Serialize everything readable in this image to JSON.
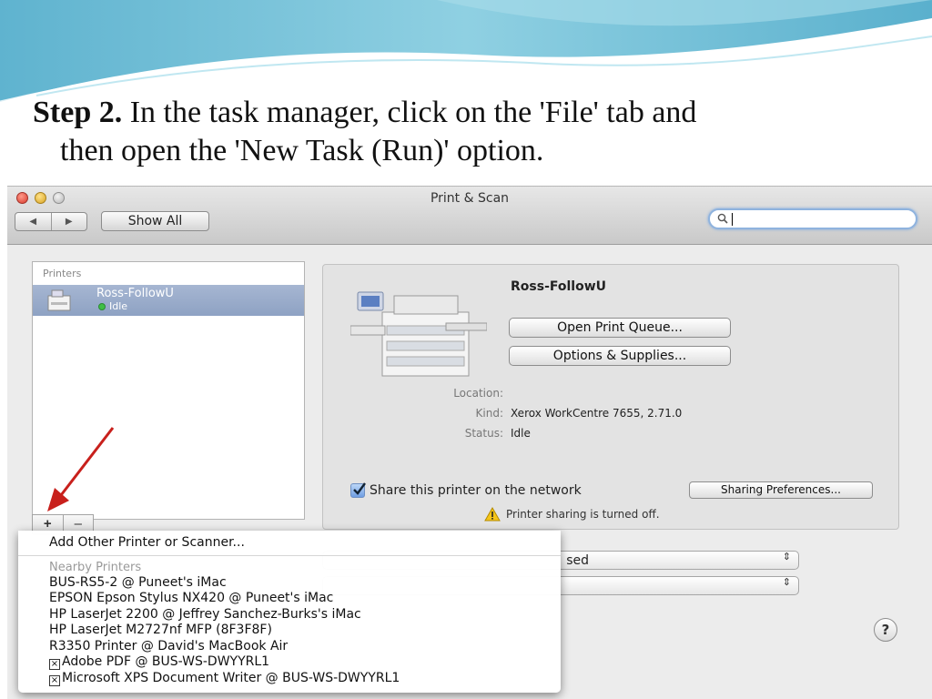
{
  "slide": {
    "step_label": "Step 2.",
    "instruction_line1": " In the task manager, click on the 'File' tab and",
    "instruction_line2": "then open the 'New Task (Run)' option."
  },
  "window": {
    "title": "Print & Scan",
    "toolbar": {
      "back_label": "◀",
      "forward_label": "▶",
      "show_all_label": "Show All",
      "search_value": ""
    }
  },
  "printers_panel": {
    "header": "Printers",
    "items": [
      {
        "name": "Ross-FollowU",
        "status": "Idle"
      }
    ],
    "add_label": "+",
    "remove_label": "–"
  },
  "detail": {
    "printer_name": "Ross-FollowU",
    "open_queue_label": "Open Print Queue...",
    "options_label": "Options & Supplies...",
    "location_label": "Location:",
    "location_value": "",
    "kind_label": "Kind:",
    "kind_value": "Xerox WorkCentre 7655, 2.71.0",
    "status_label": "Status:",
    "status_value": "Idle",
    "share_label": "Share this printer on the network",
    "share_checked": true,
    "sharing_prefs_label": "Sharing Preferences...",
    "warning_text": "Printer sharing is turned off."
  },
  "selects": {
    "default_printer_partial": "sed",
    "arrows": "⇕"
  },
  "help_label": "?",
  "add_menu": {
    "add_other_label": "Add Other Printer or Scanner...",
    "nearby_header": "Nearby Printers",
    "nearby_items": [
      "BUS-RS5-2 @ Puneet's iMac",
      "EPSON Epson Stylus NX420 @ Puneet's iMac",
      "HP LaserJet 2200 @ Jeffrey Sanchez-Burks's iMac",
      "HP LaserJet M2727nf MFP (8F3F8F)",
      "R3350 Printer @ David's MacBook Air"
    ],
    "boxed_items": [
      "Adobe PDF @ BUS-WS-DWYYRL1",
      "Microsoft XPS Document Writer @ BUS-WS-DWYYRL1"
    ]
  },
  "colors": {
    "accent_arrow": "#c8201c",
    "selection": "#98a9c8",
    "slide_wave": "#7cc3da"
  }
}
